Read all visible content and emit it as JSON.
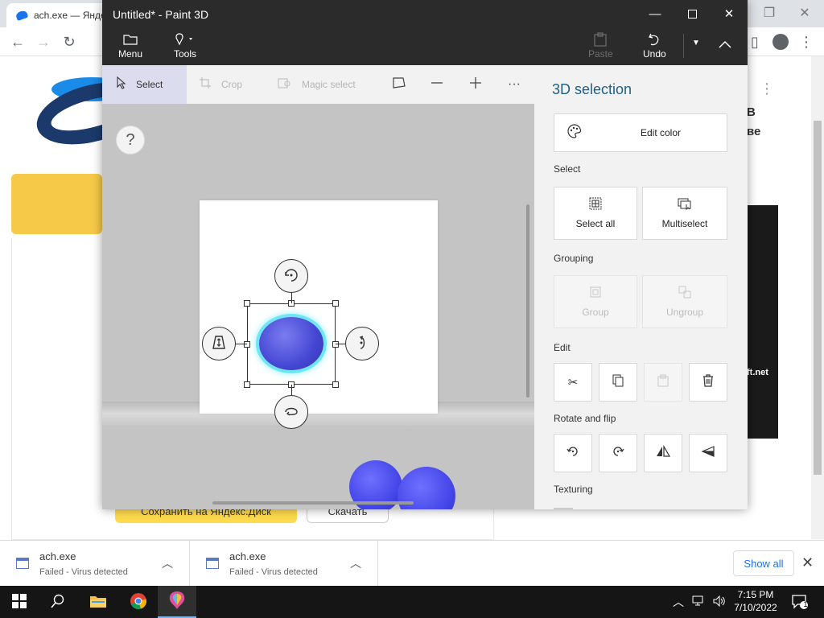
{
  "browser": {
    "tab_title": "ach.exe — Янде",
    "page_heading_right": "В\nве",
    "page_image_label": "ft.net",
    "save_yandex_button": "Сохранить на Яндекс.Диск",
    "download_button": "Скачать"
  },
  "paint3d": {
    "window_title": "Untitled* - Paint 3D",
    "ribbon": {
      "menu_label": "Menu",
      "tools_label": "Tools",
      "paste_label": "Paste",
      "undo_label": "Undo"
    },
    "toolbar": {
      "select_label": "Select",
      "crop_label": "Crop",
      "magic_select_label": "Magic select"
    },
    "help_label": "?",
    "panel": {
      "title": "3D selection",
      "edit_color_label": "Edit color",
      "select_section": "Select",
      "select_all_label": "Select all",
      "multiselect_label": "Multiselect",
      "grouping_section": "Grouping",
      "group_label": "Group",
      "ungroup_label": "Ungroup",
      "edit_section": "Edit",
      "rotate_flip_section": "Rotate and flip",
      "texturing_section": "Texturing"
    },
    "colors": {
      "object_blue": "#4547d4",
      "selection_glow": "#6ee7f5",
      "panel_title": "#1f5f86"
    }
  },
  "downloads": {
    "items": [
      {
        "name": "ach.exe",
        "status": "Failed - Virus detected"
      },
      {
        "name": "ach.exe",
        "status": "Failed - Virus detected"
      }
    ],
    "show_all_label": "Show all"
  },
  "taskbar": {
    "time": "7:15 PM",
    "date": "7/10/2022",
    "notification_count": "1"
  }
}
